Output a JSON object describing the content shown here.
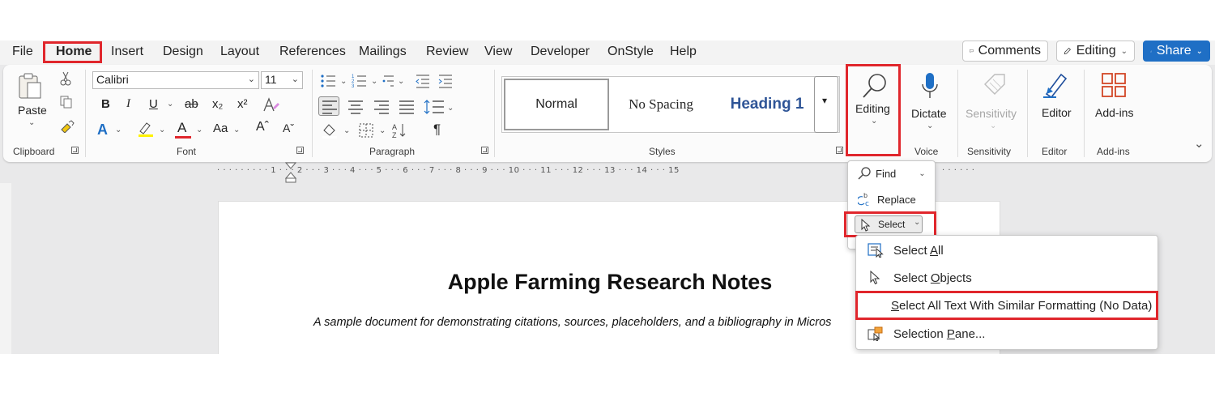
{
  "menu": {
    "tabs": [
      "File",
      "Home",
      "Insert",
      "Design",
      "Layout",
      "References",
      "Mailings",
      "Review",
      "View",
      "Developer",
      "OnStyle",
      "Help"
    ],
    "active_tab": "Home",
    "comments_label": "Comments",
    "editing_mode_label": "Editing",
    "share_label": "Share"
  },
  "clipboard": {
    "paste_label": "Paste",
    "group_label": "Clipboard"
  },
  "font": {
    "family": "Calibri",
    "size": "11",
    "bold": "B",
    "italic": "I",
    "underline": "U",
    "strike": "ab",
    "subscript": "x₂",
    "superscript": "x²",
    "change_case": "Aa",
    "grow": "Aˆ",
    "shrink": "Aˇ",
    "group_label": "Font"
  },
  "paragraph": {
    "sort_label": "↓",
    "pilcrow": "¶",
    "group_label": "Paragraph"
  },
  "styles": {
    "items": [
      "Normal",
      "No Spacing",
      "Heading 1"
    ],
    "group_label": "Styles"
  },
  "editing": {
    "label": "Editing"
  },
  "voice": {
    "dictate_label": "Dictate",
    "group_label": "Voice"
  },
  "sensitivity": {
    "label": "Sensitivity",
    "group_label": "Sensitivity"
  },
  "editor": {
    "label": "Editor",
    "group_label": "Editor"
  },
  "addins": {
    "label": "Add-ins",
    "group_label": "Add-ins"
  },
  "ruler": {
    "text": "· · · · · · · · · 1 · · · 2 · · · 3 · · · 4 · · · 5 · · · 6 · · · 7 · · · 8 · · · 9 · · · 10 · · · 11 · · · 12 · · · 13 · · · 14 · · · 15",
    "text_right": "· · · · · ·"
  },
  "document": {
    "title": "Apple Farming Research Notes",
    "subtitle": "A sample document for demonstrating citations, sources, placeholders, and a bibliography in Micros"
  },
  "editing_menu": {
    "find_label": "Find",
    "replace_label": "Replace",
    "select_label": "Select"
  },
  "select_menu": {
    "select_all_pre": "Select ",
    "select_all_key": "A",
    "select_all_post": "ll",
    "select_objects_pre": "Select ",
    "select_objects_key": "O",
    "select_objects_post": "bjects",
    "similar_key": "S",
    "similar_post": "elect All Text With Similar Formatting (No Data)",
    "pane_pre": "Selection ",
    "pane_key": "P",
    "pane_post": "ane..."
  },
  "colors": {
    "highlight_red": "#e0262c",
    "accent_blue": "#1f6fc5",
    "heading_blue": "#2f5597"
  }
}
